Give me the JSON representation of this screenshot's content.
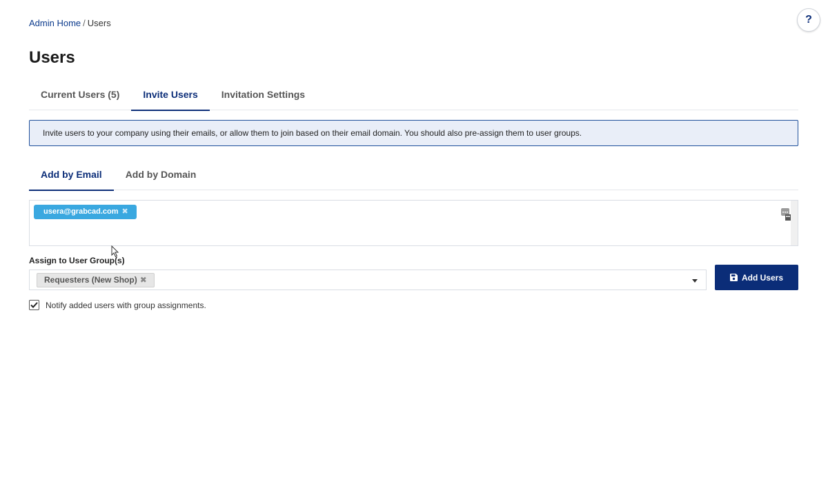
{
  "breadcrumb": {
    "home": "Admin Home",
    "separator": "/",
    "current": "Users"
  },
  "help": {
    "label": "?"
  },
  "page": {
    "title": "Users"
  },
  "tabs": [
    {
      "label": "Current Users (5)",
      "active": false
    },
    {
      "label": "Invite Users",
      "active": true
    },
    {
      "label": "Invitation Settings",
      "active": false
    }
  ],
  "info": {
    "text": "Invite users to your company using their emails, or allow them to join based on their email domain. You should also pre-assign them to user groups."
  },
  "subtabs": [
    {
      "label": "Add by Email",
      "active": true
    },
    {
      "label": "Add by Domain",
      "active": false
    }
  ],
  "emails": {
    "chips": [
      "usera@grabcad.com"
    ],
    "remove_glyph": "✖"
  },
  "assign": {
    "label": "Assign to User Group(s)",
    "groups": [
      "Requesters (New Shop)"
    ],
    "remove_glyph": "✖"
  },
  "add_button": {
    "label": "Add Users",
    "icon": "save-icon"
  },
  "notify": {
    "label": "Notify added users with group assignments.",
    "checked": true
  },
  "colors": {
    "primary": "#0b2d78",
    "chip_blue": "#3aa8e0",
    "info_bg": "#e9eef8"
  }
}
